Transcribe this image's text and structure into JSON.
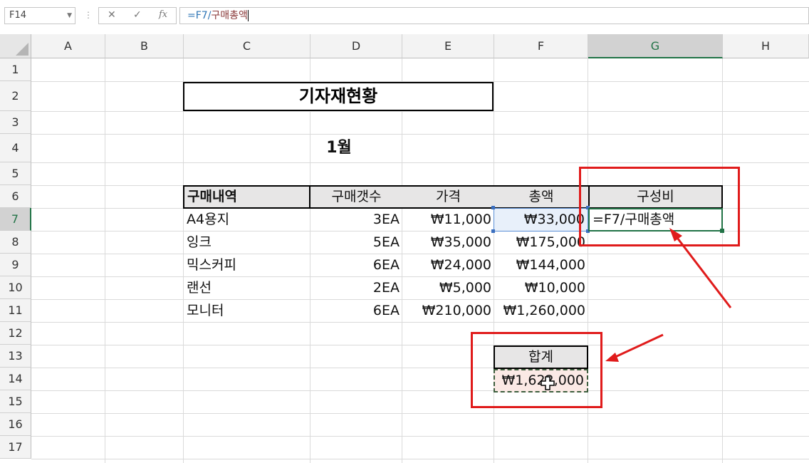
{
  "formula_bar": {
    "name_box": "F14",
    "cancel_icon": "✕",
    "enter_icon": "✓",
    "fx_label": "fx",
    "formula_ref": "=F7/",
    "formula_rest": "구매총액"
  },
  "columns": [
    "A",
    "B",
    "C",
    "D",
    "E",
    "F",
    "G",
    "H"
  ],
  "rows": [
    "1",
    "2",
    "3",
    "4",
    "5",
    "6",
    "7",
    "8",
    "9",
    "10",
    "11",
    "12",
    "13",
    "14",
    "15",
    "16",
    "17"
  ],
  "sheet": {
    "title": "기자재현황",
    "month": "1월",
    "table_header": {
      "item": "구매내역",
      "count": "구매갯수",
      "price": "가격",
      "total": "총액",
      "ratio": "구성비"
    },
    "items": [
      {
        "name": "A4용지",
        "count": "3EA",
        "price": "₩11,000",
        "total": "₩33,000"
      },
      {
        "name": "잉크",
        "count": "5EA",
        "price": "₩35,000",
        "total": "₩175,000"
      },
      {
        "name": "믹스커피",
        "count": "6EA",
        "price": "₩24,000",
        "total": "₩144,000"
      },
      {
        "name": "랜선",
        "count": "2EA",
        "price": "₩5,000",
        "total": "₩10,000"
      },
      {
        "name": "모니터",
        "count": "6EA",
        "price": "₩210,000",
        "total": "₩1,260,000"
      }
    ],
    "editing_cell": "=F7/구매총액",
    "sum_label": "합계",
    "sum_value": "₩1,622,000"
  },
  "colors": {
    "excel_green": "#217346",
    "annotation_red": "#e01b1b",
    "header_fill": "#e7e6e6"
  }
}
